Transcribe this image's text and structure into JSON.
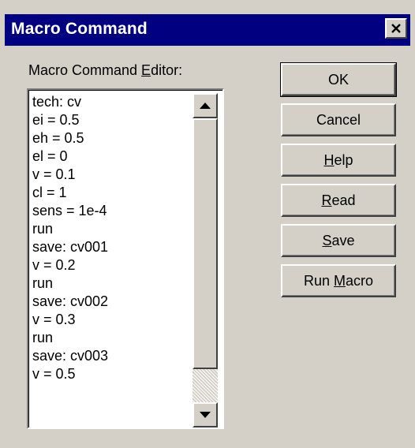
{
  "window": {
    "title": "Macro Command"
  },
  "editor": {
    "label_pre": "Macro Command ",
    "label_accel": "E",
    "label_post": "ditor:",
    "lines": [
      "tech: cv",
      "ei = 0.5",
      "eh = 0.5",
      "el = 0",
      "v = 0.1",
      "cl = 1",
      "sens = 1e-4",
      "run",
      "save: cv001",
      "v = 0.2",
      "run",
      "save: cv002",
      "v = 0.3",
      "run",
      "save: cv003",
      "v = 0.5"
    ]
  },
  "buttons": {
    "ok": {
      "label": "OK"
    },
    "cancel": {
      "label": "Cancel"
    },
    "help": {
      "pre": "",
      "accel": "H",
      "post": "elp"
    },
    "read": {
      "pre": "",
      "accel": "R",
      "post": "ead"
    },
    "save": {
      "pre": "",
      "accel": "S",
      "post": "ave"
    },
    "run_macro": {
      "pre": "Run ",
      "accel": "M",
      "post": "acro"
    }
  },
  "icons": {
    "close": "close-icon",
    "scroll_up": "arrow-up-icon",
    "scroll_down": "arrow-down-icon"
  },
  "colors": {
    "titlebar": "#000080",
    "face": "#d4d0c8"
  }
}
